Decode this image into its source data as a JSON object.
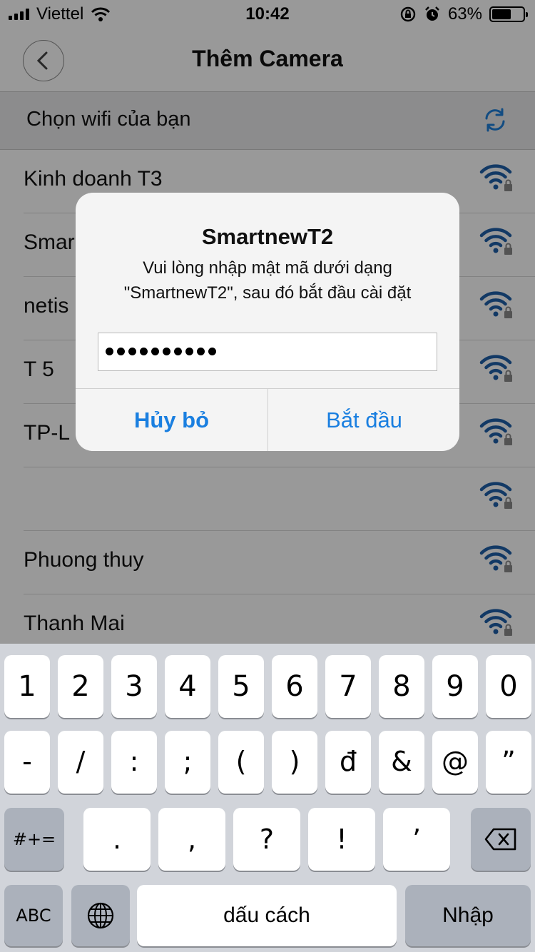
{
  "status_bar": {
    "carrier": "Viettel",
    "time": "10:42",
    "battery": "63%",
    "battery_level": 0.63
  },
  "nav": {
    "title": "Thêm Camera"
  },
  "wifi_header": {
    "label": "Chọn wifi của bạn"
  },
  "wifi_list": [
    {
      "name": "Kinh doanh T3"
    },
    {
      "name": "Smar"
    },
    {
      "name": "netis"
    },
    {
      "name": "T 5"
    },
    {
      "name": "TP-L"
    },
    {
      "name": ""
    },
    {
      "name": "Phuong thuy"
    },
    {
      "name": "Thanh Mai"
    }
  ],
  "dialog": {
    "title": "SmartnewT2",
    "message_line1": "Vui lòng nhập mật mã dưới dạng",
    "message_line2": "\"SmartnewT2\", sau đó bắt đầu cài đặt",
    "password_dot_count": 10,
    "cancel_label": "Hủy bỏ",
    "start_label": "Bắt đầu"
  },
  "keyboard": {
    "row1": [
      "1",
      "2",
      "3",
      "4",
      "5",
      "6",
      "7",
      "8",
      "9",
      "0"
    ],
    "row2": [
      "-",
      "/",
      ":",
      ";",
      "(",
      ")",
      "đ",
      "&",
      "@",
      "”"
    ],
    "row3_mode": "#+=",
    "row3": [
      ".",
      ",",
      "?",
      "!",
      "’"
    ],
    "abc_label": "ABC",
    "space_label": "dấu cách",
    "return_label": "Nhập"
  },
  "colors": {
    "accent": "#1a7fe0",
    "wifi_icon": "#1f5fa8"
  }
}
